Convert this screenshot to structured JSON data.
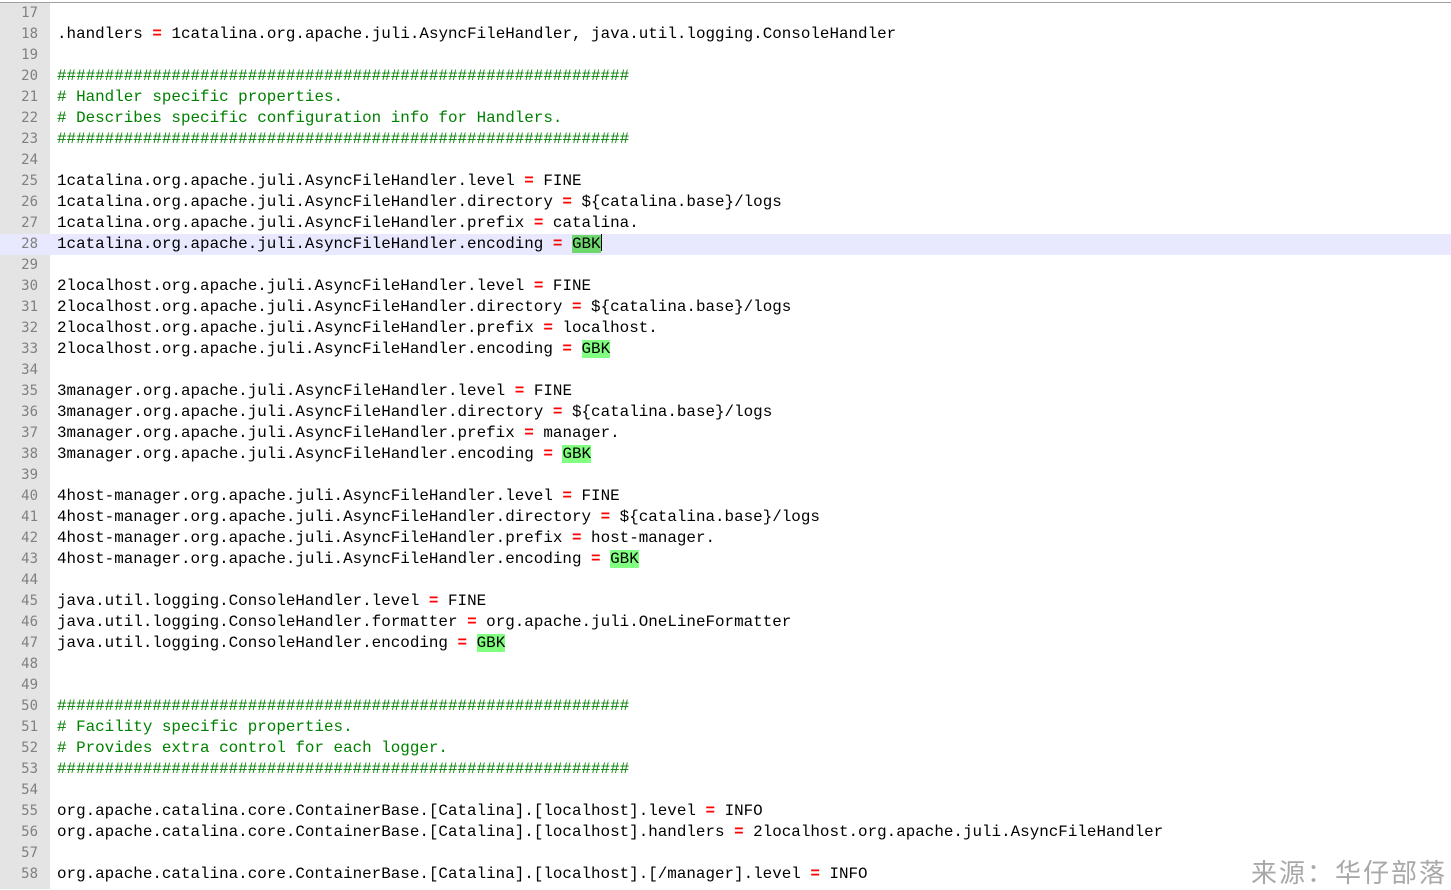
{
  "editor": {
    "lines": [
      {
        "n": "17",
        "text": ""
      },
      {
        "n": "18",
        "key": ".handlers",
        "value": "1catalina.org.apache.juli.AsyncFileHandler, java.util.logging.ConsoleHandler"
      },
      {
        "n": "19",
        "text": ""
      },
      {
        "n": "20",
        "comment": "############################################################"
      },
      {
        "n": "21",
        "comment": "# Handler specific properties."
      },
      {
        "n": "22",
        "comment": "# Describes specific configuration info for Handlers."
      },
      {
        "n": "23",
        "comment": "############################################################"
      },
      {
        "n": "24",
        "text": ""
      },
      {
        "n": "25",
        "key": "1catalina.org.apache.juli.AsyncFileHandler.level",
        "value": "FINE"
      },
      {
        "n": "26",
        "key": "1catalina.org.apache.juli.AsyncFileHandler.directory",
        "value": "${catalina.base}/logs"
      },
      {
        "n": "27",
        "key": "1catalina.org.apache.juli.AsyncFileHandler.prefix",
        "value": "catalina."
      },
      {
        "n": "28",
        "key": "1catalina.org.apache.juli.AsyncFileHandler.encoding",
        "value": "GBK",
        "highlight": true,
        "current": true
      },
      {
        "n": "29",
        "text": ""
      },
      {
        "n": "30",
        "key": "2localhost.org.apache.juli.AsyncFileHandler.level",
        "value": "FINE"
      },
      {
        "n": "31",
        "key": "2localhost.org.apache.juli.AsyncFileHandler.directory",
        "value": "${catalina.base}/logs"
      },
      {
        "n": "32",
        "key": "2localhost.org.apache.juli.AsyncFileHandler.prefix",
        "value": "localhost."
      },
      {
        "n": "33",
        "key": "2localhost.org.apache.juli.AsyncFileHandler.encoding",
        "value": "GBK",
        "highlight": true
      },
      {
        "n": "34",
        "text": ""
      },
      {
        "n": "35",
        "key": "3manager.org.apache.juli.AsyncFileHandler.level",
        "value": "FINE"
      },
      {
        "n": "36",
        "key": "3manager.org.apache.juli.AsyncFileHandler.directory",
        "value": "${catalina.base}/logs"
      },
      {
        "n": "37",
        "key": "3manager.org.apache.juli.AsyncFileHandler.prefix",
        "value": "manager."
      },
      {
        "n": "38",
        "key": "3manager.org.apache.juli.AsyncFileHandler.encoding",
        "value": "GBK",
        "highlight": true
      },
      {
        "n": "39",
        "text": ""
      },
      {
        "n": "40",
        "key": "4host-manager.org.apache.juli.AsyncFileHandler.level",
        "value": "FINE"
      },
      {
        "n": "41",
        "key": "4host-manager.org.apache.juli.AsyncFileHandler.directory",
        "value": "${catalina.base}/logs"
      },
      {
        "n": "42",
        "key": "4host-manager.org.apache.juli.AsyncFileHandler.prefix",
        "value": "host-manager."
      },
      {
        "n": "43",
        "key": "4host-manager.org.apache.juli.AsyncFileHandler.encoding",
        "value": "GBK",
        "highlight": true
      },
      {
        "n": "44",
        "text": ""
      },
      {
        "n": "45",
        "key": "java.util.logging.ConsoleHandler.level",
        "value": "FINE"
      },
      {
        "n": "46",
        "key": "java.util.logging.ConsoleHandler.formatter",
        "value": "org.apache.juli.OneLineFormatter"
      },
      {
        "n": "47",
        "key": "java.util.logging.ConsoleHandler.encoding",
        "value": "GBK",
        "highlight": true
      },
      {
        "n": "48",
        "text": ""
      },
      {
        "n": "49",
        "text": ""
      },
      {
        "n": "50",
        "comment": "############################################################"
      },
      {
        "n": "51",
        "comment": "# Facility specific properties."
      },
      {
        "n": "52",
        "comment": "# Provides extra control for each logger."
      },
      {
        "n": "53",
        "comment": "############################################################"
      },
      {
        "n": "54",
        "text": ""
      },
      {
        "n": "55",
        "key": "org.apache.catalina.core.ContainerBase.[Catalina].[localhost].level",
        "value": "INFO"
      },
      {
        "n": "56",
        "key": "org.apache.catalina.core.ContainerBase.[Catalina].[localhost].handlers",
        "value": "2localhost.org.apache.juli.AsyncFileHandler"
      },
      {
        "n": "57",
        "text": ""
      },
      {
        "n": "58",
        "key": "org.apache.catalina.core.ContainerBase.[Catalina].[localhost].[/manager].level",
        "value": "INFO"
      }
    ],
    "equals_sign": "=",
    "colors": {
      "comment": "#008000",
      "operator": "#ff0000",
      "highlight": "#80ff80",
      "current_line": "#e8e8ff",
      "gutter": "#e4e4e4"
    }
  },
  "watermark": "来源：华仔部落"
}
